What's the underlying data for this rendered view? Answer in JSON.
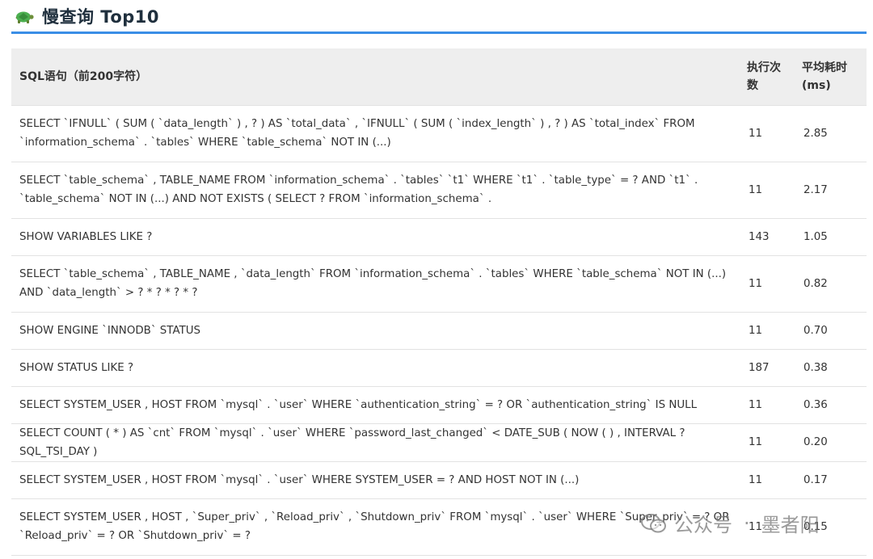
{
  "page": {
    "title": "慢查询 Top10",
    "icon": "turtle-icon"
  },
  "table": {
    "headers": {
      "sql": "SQL语句（前200字符）",
      "count": "执行次数",
      "avg": "平均耗时(ms)"
    },
    "rows": [
      {
        "sql": "SELECT `IFNULL` ( SUM ( `data_length` ) , ? ) AS `total_data` , `IFNULL` ( SUM ( `index_length` ) , ? ) AS `total_index` FROM `information_schema` . `tables` WHERE `table_schema` NOT IN (...)",
        "count": "11",
        "avg": "2.85"
      },
      {
        "sql": "SELECT `table_schema` , TABLE_NAME FROM `information_schema` . `tables` `t1` WHERE `t1` . `table_type` = ? AND `t1` . `table_schema` NOT IN (...) AND NOT EXISTS ( SELECT ? FROM `information_schema` .",
        "count": "11",
        "avg": "2.17"
      },
      {
        "sql": "SHOW VARIABLES LIKE ?",
        "count": "143",
        "avg": "1.05"
      },
      {
        "sql": "SELECT `table_schema` , TABLE_NAME , `data_length` FROM `information_schema` . `tables` WHERE `table_schema` NOT IN (...) AND `data_length` > ? * ? * ? * ?",
        "count": "11",
        "avg": "0.82"
      },
      {
        "sql": "SHOW ENGINE `INNODB` STATUS",
        "count": "11",
        "avg": "0.70"
      },
      {
        "sql": "SHOW STATUS LIKE ?",
        "count": "187",
        "avg": "0.38"
      },
      {
        "sql": "SELECT SYSTEM_USER , HOST FROM `mysql` . `user` WHERE `authentication_string` = ? OR `authentication_string` IS NULL",
        "count": "11",
        "avg": "0.36"
      },
      {
        "sql": "SELECT COUNT ( * ) AS `cnt` FROM `mysql` . `user` WHERE `password_last_changed` < DATE_SUB ( NOW ( ) , INTERVAL ? SQL_TSI_DAY )",
        "count": "11",
        "avg": "0.20"
      },
      {
        "sql": "SELECT SYSTEM_USER , HOST FROM `mysql` . `user` WHERE SYSTEM_USER = ? AND HOST NOT IN (...)",
        "count": "11",
        "avg": "0.17"
      },
      {
        "sql": "SELECT SYSTEM_USER , HOST , `Super_priv` , `Reload_priv` , `Shutdown_priv` FROM `mysql` . `user` WHERE `Super_priv` = ? OR `Reload_priv` = ? OR `Shutdown_priv` = ?",
        "count": "11",
        "avg": "0.15"
      }
    ]
  },
  "watermark": {
    "account": "公众号",
    "name": "墨者阳",
    "icon": "wechat-icon"
  }
}
